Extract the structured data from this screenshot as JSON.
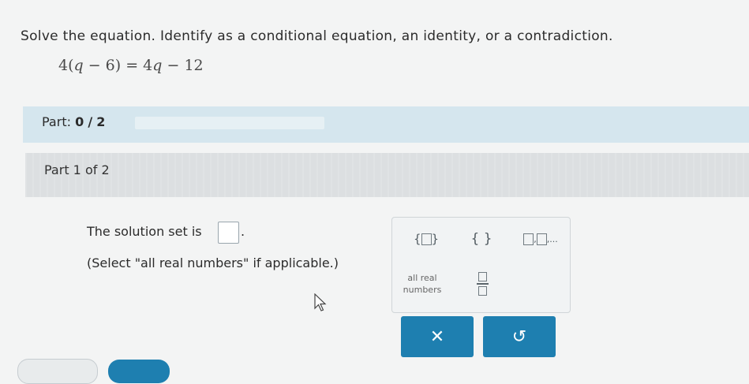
{
  "question": {
    "prompt": "Solve the equation. Identify as a conditional equation, an identity, or a contradiction.",
    "equation": {
      "coef_left": "4",
      "open": "(",
      "var": "q",
      "minus": " − 6) = 4",
      "var2": "q",
      "rest": " − 12"
    }
  },
  "progress": {
    "label": "Part:",
    "current": "0",
    "separator": "/",
    "total": "2",
    "fraction_complete": 0
  },
  "part_header": {
    "title": "Part 1 of 2"
  },
  "body": {
    "solution_text": "The solution set is",
    "period": ".",
    "hint": "(Select \"all real numbers\" if applicable.)"
  },
  "palette": {
    "set_left": "{",
    "set_right": "}",
    "empty_set": "{ }",
    "list_sep": ",",
    "list_ellipsis": ",...",
    "all_real_line1": "all real",
    "all_real_line2": "numbers"
  },
  "actions": {
    "clear_symbol": "✕",
    "undo_symbol": "↺"
  },
  "colors": {
    "primary": "#1e7fb0",
    "part_bar": "#d5e6ee",
    "part_header": "#dcdfe1"
  }
}
